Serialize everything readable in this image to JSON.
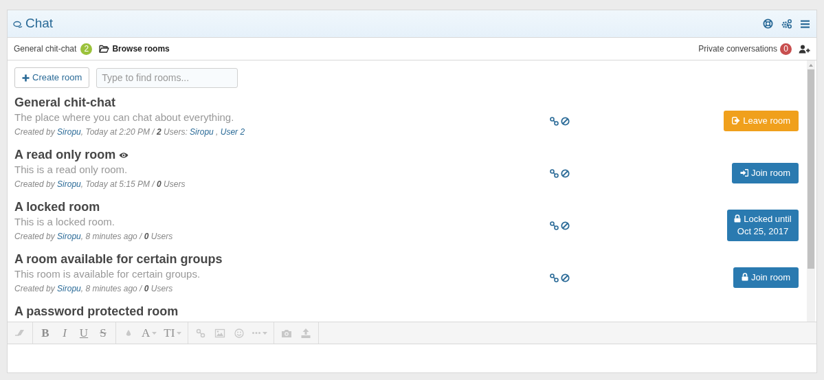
{
  "header": {
    "title": "Chat"
  },
  "tabs": [
    {
      "label": "General chit-chat",
      "count": "2",
      "selected": false,
      "kind": "room"
    },
    {
      "label": "Browse rooms",
      "selected": true,
      "kind": "browse"
    }
  ],
  "private": {
    "label": "Private conversations",
    "count": "0"
  },
  "create_button": "Create room",
  "search": {
    "placeholder": "Type to find rooms..."
  },
  "rooms": [
    {
      "title": "General chit-chat",
      "read_only": false,
      "description": "The place where you can chat about everything.",
      "meta": [
        {
          "kind": "text",
          "text": "Created by "
        },
        {
          "kind": "link",
          "text": "Siropu"
        },
        {
          "kind": "text",
          "text": ", Today at 2:20 PM / "
        },
        {
          "kind": "bold",
          "text": "2"
        },
        {
          "kind": "text",
          "text": " Users: "
        },
        {
          "kind": "link",
          "text": "Siropu"
        },
        {
          "kind": "text",
          "text": " , "
        },
        {
          "kind": "link",
          "text": "User 2"
        }
      ],
      "button": {
        "kind": "leave",
        "label": "Leave room"
      }
    },
    {
      "title": "A read only room",
      "read_only": true,
      "description": "This is a read only room.",
      "meta": [
        {
          "kind": "text",
          "text": "Created by "
        },
        {
          "kind": "link",
          "text": "Siropu"
        },
        {
          "kind": "text",
          "text": ", Today at 5:15 PM / "
        },
        {
          "kind": "bold",
          "text": "0"
        },
        {
          "kind": "text",
          "text": " Users"
        }
      ],
      "button": {
        "kind": "join",
        "label": "Join room"
      }
    },
    {
      "title": "A locked room",
      "read_only": false,
      "description": "This is a locked room.",
      "meta": [
        {
          "kind": "text",
          "text": "Created by "
        },
        {
          "kind": "link",
          "text": "Siropu"
        },
        {
          "kind": "text",
          "text": ", 8 minutes ago / "
        },
        {
          "kind": "bold",
          "text": "0"
        },
        {
          "kind": "text",
          "text": " Users"
        }
      ],
      "button": {
        "kind": "locked",
        "label": "Locked until Oct 25, 2017"
      }
    },
    {
      "title": "A room available for certain groups",
      "read_only": false,
      "description": "This room is available for certain groups.",
      "meta": [
        {
          "kind": "text",
          "text": "Created by "
        },
        {
          "kind": "link",
          "text": "Siropu"
        },
        {
          "kind": "text",
          "text": ", 8 minutes ago / "
        },
        {
          "kind": "bold",
          "text": "0"
        },
        {
          "kind": "text",
          "text": " Users"
        }
      ],
      "button": {
        "kind": "protected",
        "label": "Join room"
      }
    },
    {
      "title": "A password protected room",
      "read_only": false
    }
  ],
  "toolbar": {
    "disabled": true,
    "groups": [
      [
        {
          "kind": "eraser"
        }
      ],
      [
        {
          "kind": "bold",
          "label": "B"
        },
        {
          "kind": "italic",
          "label": "I"
        },
        {
          "kind": "underline",
          "label": "U"
        },
        {
          "kind": "strike",
          "label": "S"
        }
      ],
      [
        {
          "kind": "drop"
        },
        {
          "kind": "plain",
          "label": "A",
          "dropdown": true
        },
        {
          "kind": "plain",
          "label": "TI",
          "dropdown": true
        }
      ],
      [
        {
          "kind": "link"
        },
        {
          "kind": "image"
        },
        {
          "kind": "smile"
        },
        {
          "kind": "more",
          "dropdown": true
        }
      ],
      [
        {
          "kind": "camera"
        },
        {
          "kind": "upload"
        }
      ]
    ]
  }
}
